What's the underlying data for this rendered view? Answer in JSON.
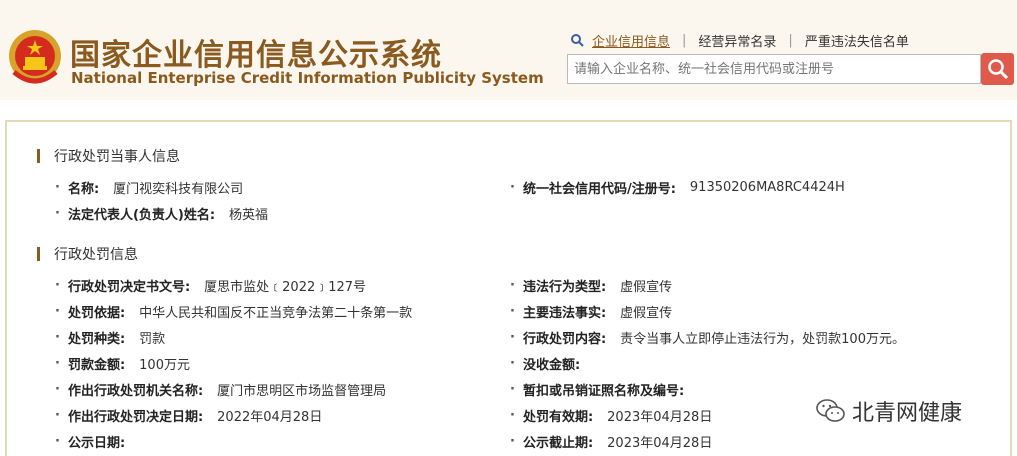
{
  "header": {
    "title_cn": "国家企业信用信息公示系统",
    "title_en": "National Enterprise Credit Information Publicity System"
  },
  "topnav": {
    "items": [
      "企业信用信息",
      "经营异常名录",
      "严重违法失信名单"
    ]
  },
  "search": {
    "placeholder": "请输入企业名称、统一社会信用代码或注册号"
  },
  "party_section": {
    "title": "行政处罚当事人信息",
    "name_label": "名称:",
    "name_value": "厦门视奕科技有限公司",
    "credit_code_label": "统一社会信用代码/注册号:",
    "credit_code_value": "91350206MA8RC4424H",
    "legal_rep_label": "法定代表人(负责人)姓名:",
    "legal_rep_value": "杨英福"
  },
  "penalty_section": {
    "title": "行政处罚信息",
    "left": [
      {
        "label": "行政处罚决定书文号:",
        "value": "厦思市监处﹝2022﹞127号"
      },
      {
        "label": "处罚依据:",
        "value": "中华人民共和国反不正当竞争法第二十条第一款"
      },
      {
        "label": "处罚种类:",
        "value": "罚款"
      },
      {
        "label": "罚款金额:",
        "value": "100万元"
      },
      {
        "label": "作出行政处罚机关名称:",
        "value": "厦门市思明区市场监督管理局"
      },
      {
        "label": "作出行政处罚决定日期:",
        "value": "2022年04月28日"
      },
      {
        "label": "公示日期:",
        "value": ""
      }
    ],
    "right": [
      {
        "label": "违法行为类型:",
        "value": "虚假宣传"
      },
      {
        "label": "主要违法事实:",
        "value": "虚假宣传"
      },
      {
        "label": "行政处罚内容:",
        "value": "责令当事人立即停止违法行为，处罚款100万元。"
      },
      {
        "label": "没收金额:",
        "value": ""
      },
      {
        "label": "暂扣或吊销证照名称及编号:",
        "value": ""
      },
      {
        "label": "处罚有效期:",
        "value": "2023年04月28日"
      },
      {
        "label": "公示截止期:",
        "value": "2023年04月28日"
      }
    ]
  },
  "watermark": {
    "text": "北青网健康"
  },
  "colors": {
    "brand": "#8a5a1f",
    "search_button": "#e05a4b",
    "card_border": "#e6d9b8"
  }
}
